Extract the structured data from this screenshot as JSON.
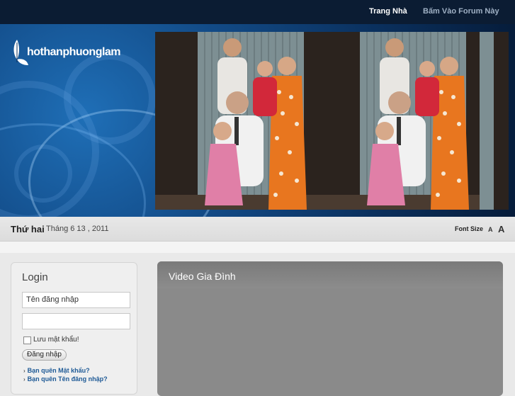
{
  "nav": {
    "home": "Trang Nhà",
    "forum": "Bấm Vào Forum Này"
  },
  "logo": {
    "text": "hothanphuonglam"
  },
  "date_bar": {
    "day": "Thứ hai",
    "date": "Tháng 6 13 , 2011",
    "font_size_label": "Font Size",
    "font_small": "A",
    "font_large": "A"
  },
  "login": {
    "title": "Login",
    "username_placeholder": "Tên đăng nhập",
    "remember_label": "Lưu mật khẩu!",
    "submit": "Đăng nhập",
    "forgot_password": "Bạn quên Mật khẩu?",
    "forgot_username": "Bạn quên Tên đăng nhập?"
  },
  "video": {
    "title": "Video Gia Đình"
  },
  "colors": {
    "nav_bg": "#0b1c33",
    "banner_blue": "#124a86",
    "link": "#1e5a96"
  }
}
